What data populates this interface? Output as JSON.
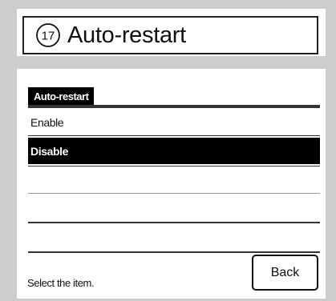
{
  "header": {
    "step_number": "17",
    "title": "Auto-restart"
  },
  "section": {
    "label": "Auto-restart"
  },
  "options": [
    {
      "label": "Enable",
      "selected": false
    },
    {
      "label": "Disable",
      "selected": true
    }
  ],
  "buttons": {
    "back_label": "Back"
  },
  "status": {
    "text": "Select the item."
  }
}
